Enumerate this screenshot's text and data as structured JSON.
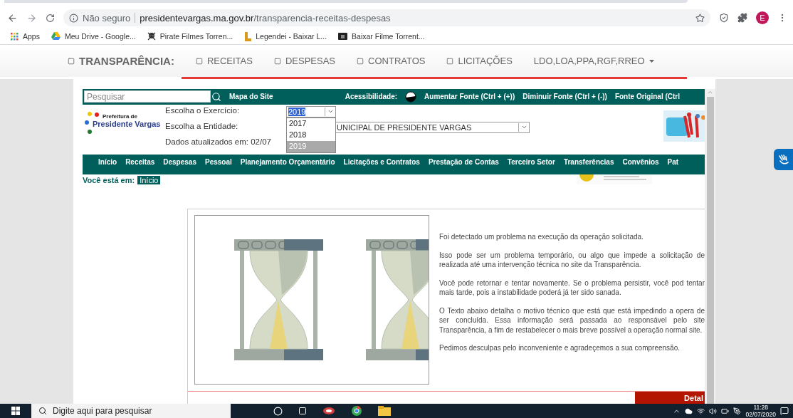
{
  "browser": {
    "security": "Não seguro",
    "url_host": "presidentevargas.ma.gov.br",
    "url_path": "/transparencia-receitas-despesas",
    "profile_initial": "E",
    "bookmarks": [
      {
        "kind": "apps",
        "label": "Apps"
      },
      {
        "kind": "drive",
        "label": "Meu Drive - Google..."
      },
      {
        "kind": "pirate",
        "label": "Pirate Filmes Torren..."
      },
      {
        "kind": "legendei",
        "label": "Legendei - Baixar L..."
      },
      {
        "kind": "film",
        "label": "Baixar Filme Torrent..."
      }
    ]
  },
  "site_nav": {
    "items": [
      {
        "kind": "title",
        "label": "TRANSPARÊNCIA:"
      },
      {
        "kind": "link",
        "label": "RECEITAS"
      },
      {
        "kind": "link",
        "label": "DESPESAS"
      },
      {
        "kind": "link",
        "label": "CONTRATOS"
      },
      {
        "kind": "link",
        "label": "LICITAÇÕES"
      },
      {
        "kind": "menu",
        "label": "LDO,LOA,PPA,RGF,RREO"
      }
    ]
  },
  "top_bar": {
    "search_placeholder": "Pesquisar",
    "site_map": "Mapa do Site",
    "accessibility_label": "Acessibilidade:",
    "accessibility_links": [
      "Aumentar Fonte (Ctrl + (+))",
      "Diminuir Fonte (Ctrl + (-))",
      "Fonte Original (Ctrl"
    ]
  },
  "logo": {
    "line_1": "Prefeitura de",
    "line_2": "Presidente Vargas"
  },
  "form": {
    "exercise_label": "Escolha o Exercício:",
    "exercise_value": "2019",
    "options": [
      {
        "label": "2017",
        "selected": false
      },
      {
        "label": "2018",
        "selected": false
      },
      {
        "label": "2019",
        "selected": true
      }
    ],
    "entity_label": "Escolha a Entidade:",
    "entity_value": "UNICIPAL DE PRESIDENTE VARGAS",
    "updated": "Dados atualizados em: 02/07"
  },
  "main_menu": [
    "Início",
    "Receitas",
    "Despesas",
    "Pessoal",
    "Planejamento Orçamentário",
    "Licitações e Contratos",
    "Prestação de Contas",
    "Terceiro Setor",
    "Transferências",
    "Convênios",
    "Pat"
  ],
  "breadcrumb": {
    "label": "Você está em:",
    "current": "Início"
  },
  "error": {
    "paragraphs": [
      "Foi detectado um problema na execução da operação solicitada.",
      "Isso pode ser um problema temporário, ou algo que impede a solicitação de realizada até uma intervenção técnica no site da Transparência.",
      "Você pode retornar e tentar novamente. Se o problema persistir, você pod tentar mais tarde, pois a instabilidade poderá já ter sido sanada.",
      "O Texto abaixo detalha o motivo técnico que está que está impedindo a opera de ser concluída. Essa informação será passada ao responsável pelo site Transparência, a fim de restabelecer o mais breve possível a operação normal site.",
      "Pedimos desculpas pelo inconveniente e agradeçemos a sua compreensão."
    ],
    "button": "Detal"
  },
  "taskbar": {
    "search_placeholder": "Digite aqui para pesquisar",
    "time": "11:28",
    "date": "02/07/2020"
  }
}
